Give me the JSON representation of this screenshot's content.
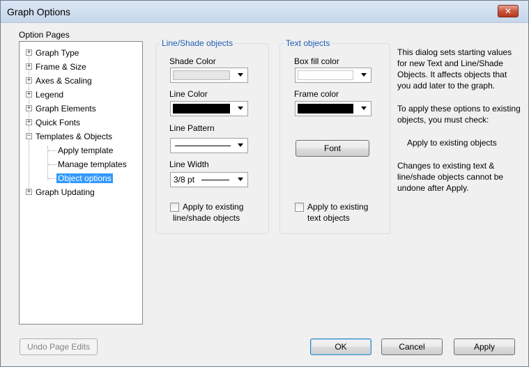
{
  "window": {
    "title": "Graph Options",
    "close_icon": "close-icon"
  },
  "option_pages": {
    "label": "Option Pages",
    "items": [
      {
        "label": "Graph Type",
        "expander": "+"
      },
      {
        "label": "Frame & Size",
        "expander": "+"
      },
      {
        "label": "Axes & Scaling",
        "expander": "+"
      },
      {
        "label": "Legend",
        "expander": "+"
      },
      {
        "label": "Graph Elements",
        "expander": "+"
      },
      {
        "label": "Quick Fonts",
        "expander": "+"
      },
      {
        "label": "Templates & Objects",
        "expander": "−"
      },
      {
        "label": "Apply template"
      },
      {
        "label": "Manage templates"
      },
      {
        "label": "Object options",
        "selected": true
      },
      {
        "label": "Graph Updating",
        "expander": "+"
      }
    ],
    "selection_color": "#3399ff"
  },
  "line_shade": {
    "legend": "Line/Shade objects",
    "shade_color_label": "Shade Color",
    "shade_color_value": "#e6e6e6",
    "line_color_label": "Line Color",
    "line_color_value": "#000000",
    "line_pattern_label": "Line Pattern",
    "line_width_label": "Line Width",
    "line_width_value": "3/8 pt",
    "apply_existing_line1": "Apply to existing",
    "apply_existing_line2": "line/shade objects",
    "apply_existing_checked": false
  },
  "text_objects": {
    "legend": "Text objects",
    "box_fill_label": "Box fill color",
    "box_fill_value": "#ffffff",
    "frame_color_label": "Frame color",
    "frame_color_value": "#000000",
    "font_button": "Font",
    "apply_existing_line1": "Apply to existing",
    "apply_existing_line2": "text objects",
    "apply_existing_checked": false
  },
  "info": {
    "para1": "This dialog sets starting values for new Text and Line/Shade Objects.  It affects objects that you add later to the graph.",
    "para2": "To apply these options to existing objects, you must check:",
    "para3": "Apply to existing objects",
    "para4": "Changes to existing text & line/shade objects cannot be undone after Apply."
  },
  "buttons": {
    "undo": "Undo Page Edits",
    "ok": "OK",
    "cancel": "Cancel",
    "apply": "Apply"
  },
  "colors": {
    "group_legend": "#1e5fb4",
    "titlebar": "#c6d7eb",
    "dialog_bg": "#f0f0f0"
  }
}
